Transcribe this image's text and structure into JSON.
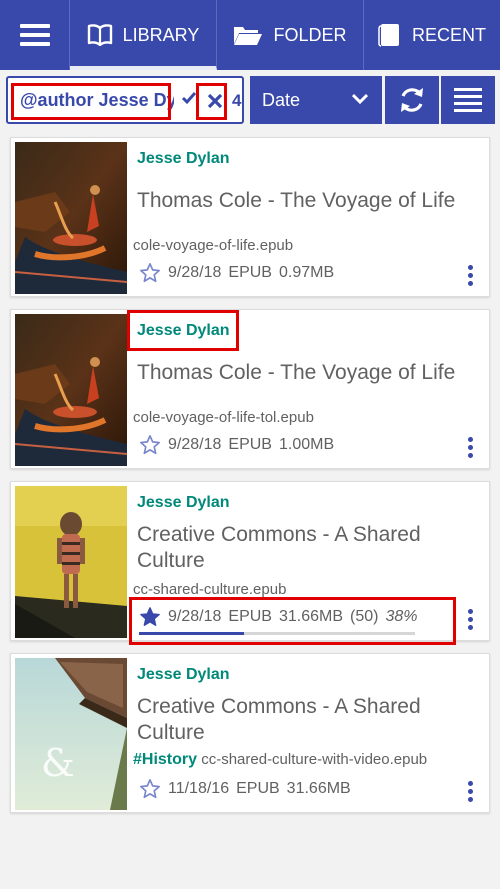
{
  "nav": {
    "tabs": [
      {
        "label": "LIBRARY",
        "icon": "book-icon",
        "selected": true
      },
      {
        "label": "FOLDER",
        "icon": "folder-icon"
      },
      {
        "label": "RECENT",
        "icon": "recent-icon"
      }
    ]
  },
  "filter": {
    "search_value": "@author Jesse Dylan",
    "result_count": "4",
    "sort_label": "Date"
  },
  "books": [
    {
      "author": "Jesse Dylan",
      "title": "Thomas Cole - The Voyage of Life",
      "tag": "",
      "file": "cole-voyage-of-life.epub",
      "date": "9/28/18",
      "format": "EPUB",
      "size": "0.97MB",
      "pages": "",
      "percent": "",
      "progress": 0,
      "starred": false
    },
    {
      "author": "Jesse Dylan",
      "title": "Thomas Cole - The Voyage of Life",
      "tag": "",
      "file": "cole-voyage-of-life-tol.epub",
      "date": "9/28/18",
      "format": "EPUB",
      "size": "1.00MB",
      "pages": "",
      "percent": "",
      "progress": 0,
      "starred": false
    },
    {
      "author": "Jesse Dylan",
      "title": "Creative Commons - A Shared Culture",
      "tag": "",
      "file": "cc-shared-culture.epub",
      "date": "9/28/18",
      "format": "EPUB",
      "size": "31.66MB",
      "pages": "(50)",
      "percent": "38%",
      "progress": 0.38,
      "starred": true
    },
    {
      "author": "Jesse Dylan",
      "title": "Creative Commons - A Shared Culture",
      "tag": "#History",
      "file": "cc-shared-culture-with-video.epub",
      "date": "11/18/16",
      "format": "EPUB",
      "size": "31.66MB",
      "pages": "",
      "percent": "",
      "progress": 0,
      "starred": false
    }
  ],
  "colors": {
    "primary": "#3949ab",
    "author": "#00897b",
    "highlight": "#e00000"
  }
}
